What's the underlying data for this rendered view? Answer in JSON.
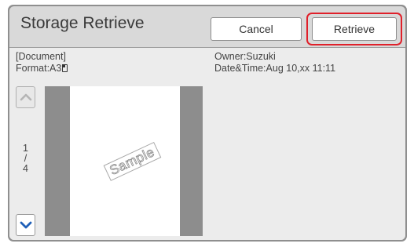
{
  "header": {
    "title": "Storage Retrieve",
    "cancel_label": "Cancel",
    "retrieve_label": "Retrieve"
  },
  "document": {
    "kind": "[Document]",
    "format_label": "Format:A3",
    "owner": "Owner:Suzuki",
    "datetime": "Date&Time:Aug 10,xx 11:11"
  },
  "preview": {
    "watermark": "Sample",
    "page_current": "1",
    "page_separator": "/",
    "page_total": "4"
  },
  "icons": {
    "up": "chevron-up-icon",
    "down": "chevron-down-icon",
    "format": "paper-orientation-icon"
  },
  "colors": {
    "highlight": "#e0202a",
    "chevron_active": "#2060b8",
    "chevron_disabled": "#b5b5b5"
  }
}
